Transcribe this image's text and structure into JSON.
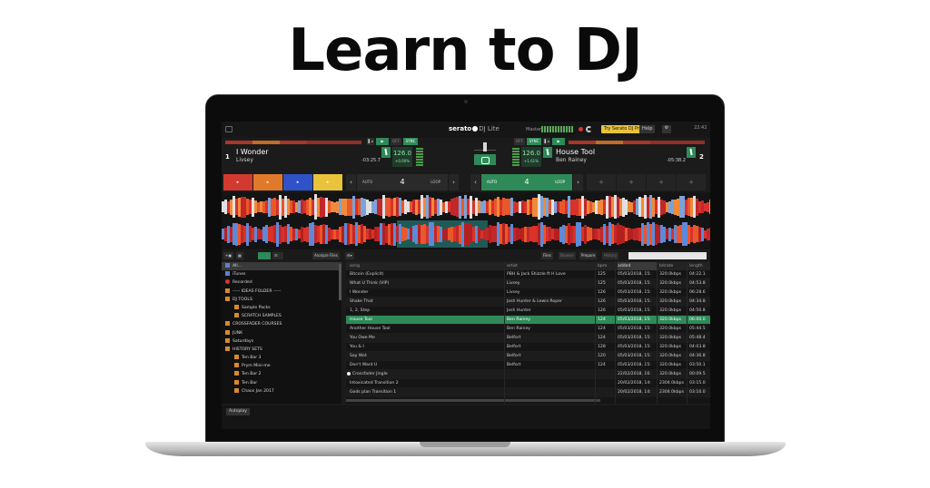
{
  "headline": "Learn to DJ",
  "app": {
    "logo": "serato",
    "logo_sub": "DJ Lite",
    "master_label": "Master",
    "try_button": "Try Serato DJ Pro",
    "help_label": "Help",
    "clock": "22:42"
  },
  "deck_left": {
    "number": "1",
    "title": "I Wonder",
    "artist": "Livsey",
    "time": "-03:25.7",
    "bpm": "126.0",
    "pitch": "+0.00%",
    "sync": "SYNC",
    "cues": [
      "#d23a2f",
      "#e07a2a",
      "#2f52c8",
      "#e9c33a"
    ],
    "loop_auto": "AUTO",
    "loop_value": "4",
    "loop_label": "LOOP"
  },
  "deck_right": {
    "number": "2",
    "title": "House Tool",
    "artist": "Ben Rainey",
    "time": "-05:38.2",
    "bpm": "126.0",
    "pitch": "+1.61%",
    "sync": "SYNC",
    "loop_auto": "AUTO",
    "loop_value": "4",
    "loop_label": "LOOP"
  },
  "library_tools": {
    "analyze": "Analyze Files",
    "files": "Files",
    "browse": "Browse",
    "prepare": "Prepare",
    "history": "History"
  },
  "crates": [
    {
      "label": "All...",
      "icon": "blue",
      "indent": false,
      "selected": true
    },
    {
      "label": "iTunes",
      "icon": "blue",
      "indent": false
    },
    {
      "label": "Recorded",
      "icon": "red",
      "indent": false
    },
    {
      "label": "----- IDEAS FOLDER -----",
      "icon": "orange",
      "indent": false
    },
    {
      "label": "DJ TOOLS",
      "icon": "orange",
      "indent": false
    },
    {
      "label": "Sample Packs",
      "icon": "orange",
      "indent": true
    },
    {
      "label": "SCRATCH SAMPLES",
      "icon": "orange",
      "indent": true
    },
    {
      "label": "CROSSFADER COURSES",
      "icon": "orange",
      "indent": false
    },
    {
      "label": "JUNK",
      "icon": "orange",
      "indent": false
    },
    {
      "label": "Saturdays",
      "icon": "orange",
      "indent": false
    },
    {
      "label": "HISTORY SETS",
      "icon": "orange",
      "indent": false
    },
    {
      "label": "Ten Bar 3",
      "icon": "orange",
      "indent": true
    },
    {
      "label": "Prym Mini-me",
      "icon": "orange",
      "indent": true
    },
    {
      "label": "Ten Bar 2",
      "icon": "orange",
      "indent": true
    },
    {
      "label": "Ten Bar",
      "icon": "orange",
      "indent": true
    },
    {
      "label": "Chaos Jan 2017",
      "icon": "orange",
      "indent": true
    }
  ],
  "table": {
    "columns": [
      "song",
      "artist",
      "bpm",
      "added",
      "bitrate",
      "length"
    ],
    "rows": [
      {
        "song": "Bitcoin (Explicit)",
        "artist": "PBH & Jack Shizzle ft H Love",
        "bpm": "125",
        "added": "05/03/2018, 15:",
        "bitrate": "320.0kbps",
        "length": "04:22.1"
      },
      {
        "song": "What U Think (VIP)",
        "artist": "Livsey",
        "bpm": "125",
        "added": "05/03/2018, 15:",
        "bitrate": "320.0kbps",
        "length": "04:53.8"
      },
      {
        "song": "I Wonder",
        "artist": "Livsey",
        "bpm": "126",
        "added": "05/03/2018, 15:",
        "bitrate": "320.0kbps",
        "length": "06:28.6"
      },
      {
        "song": "Shake That",
        "artist": "Josh Hunter & Lewis Roper",
        "bpm": "126",
        "added": "05/03/2018, 15:",
        "bitrate": "320.0kbps",
        "length": "04:34.8"
      },
      {
        "song": "1, 2, Step",
        "artist": "Josh Hunter",
        "bpm": "126",
        "added": "05/03/2018, 15:",
        "bitrate": "320.0kbps",
        "length": "04:50.8"
      },
      {
        "song": "House Tool",
        "artist": "Ben Rainey",
        "bpm": "124",
        "added": "05/03/2018, 15:",
        "bitrate": "320.0kbps",
        "length": "06:00.0",
        "highlight": true
      },
      {
        "song": "Another House Tool",
        "artist": "Ben Rainey",
        "bpm": "124",
        "added": "05/03/2018, 15:",
        "bitrate": "320.0kbps",
        "length": "05:44.5"
      },
      {
        "song": "You Owe Me",
        "artist": "Belfort",
        "bpm": "124",
        "added": "05/03/2018, 15:",
        "bitrate": "320.0kbps",
        "length": "05:48.4"
      },
      {
        "song": "You & I",
        "artist": "Belfort",
        "bpm": "128",
        "added": "05/03/2018, 15:",
        "bitrate": "320.0kbps",
        "length": "04:03.8"
      },
      {
        "song": "Say Wot",
        "artist": "Belfort",
        "bpm": "120",
        "added": "05/03/2018, 15:",
        "bitrate": "320.0kbps",
        "length": "04:36.8"
      },
      {
        "song": "Don't Want U",
        "artist": "Belfort",
        "bpm": "124",
        "added": "05/03/2018, 15:",
        "bitrate": "320.0kbps",
        "length": "03:50.1"
      },
      {
        "song": "Crossfader Jingle",
        "artist": "",
        "bpm": "",
        "added": "22/02/2018, 16:",
        "bitrate": "320.0kbps",
        "length": "00:09.5",
        "dot": true
      },
      {
        "song": "Intoxicated Transition 2",
        "artist": "",
        "bpm": "",
        "added": "20/02/2018, 14:",
        "bitrate": "2304.0kbps",
        "length": "03:15.0"
      },
      {
        "song": "Gods plan Transition 1",
        "artist": "",
        "bpm": "",
        "added": "20/02/2018, 14:",
        "bitrate": "2304.0kbps",
        "length": "03:10.0"
      }
    ]
  },
  "autoplay": "Autoplay"
}
